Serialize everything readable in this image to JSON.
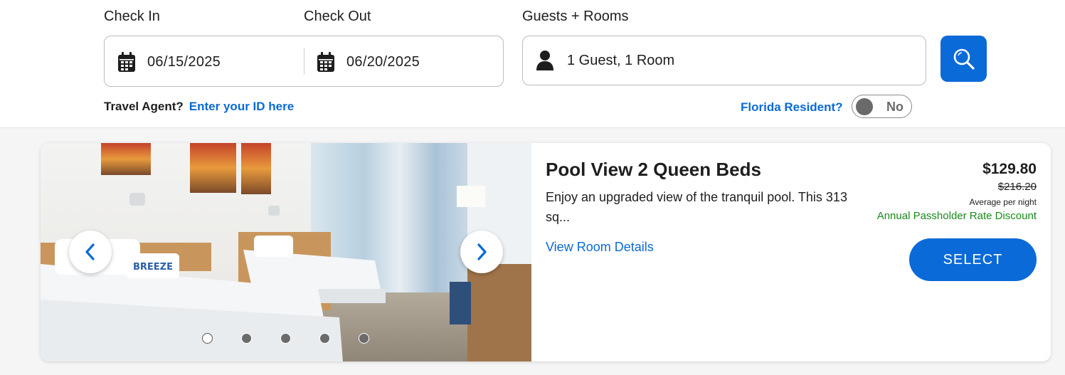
{
  "search": {
    "check_in_label": "Check In",
    "check_out_label": "Check Out",
    "guests_label": "Guests + Rooms",
    "check_in_value": "06/15/2025",
    "check_out_value": "06/20/2025",
    "guests_value": "1 Guest, 1 Room",
    "search_icon": "magnifier-icon"
  },
  "travel_agent": {
    "question": "Travel Agent?",
    "link": "Enter your ID here"
  },
  "florida": {
    "link": "Florida Resident?",
    "toggle_label": "No"
  },
  "room": {
    "title": "Pool View 2 Queen Beds",
    "description": "Enjoy an upgraded view of the tranquil pool. This 313 sq...",
    "details_link": "View Room Details",
    "price": "$129.80",
    "original_price": "$216.20",
    "price_note": "Average per night",
    "discount": "Annual Passholder Rate Discount",
    "select_label": "SELECT",
    "image_count": 5,
    "active_image": 1
  },
  "colors": {
    "accent": "#0a6ad8",
    "discount": "#1a8a1a"
  }
}
